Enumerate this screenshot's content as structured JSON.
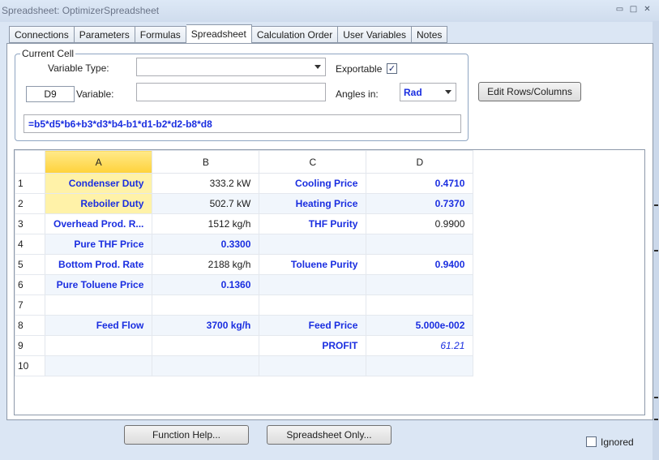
{
  "window": {
    "title": "Spreadsheet: OptimizerSpreadsheet",
    "controls": [
      "▭",
      "□",
      "✕"
    ]
  },
  "tabs": [
    "Connections",
    "Parameters",
    "Formulas",
    "Spreadsheet",
    "Calculation Order",
    "User Variables",
    "Notes"
  ],
  "active_tab": "Spreadsheet",
  "current_cell": {
    "legend": "Current Cell",
    "variable_type_label": "Variable Type:",
    "variable_type_value": "",
    "exportable_label": "Exportable",
    "exportable_checked": "✓",
    "cell_ref": "D9",
    "variable_label": "Variable:",
    "variable_value": "",
    "angles_label": "Angles in:",
    "angles_value": "Rad",
    "formula": "=b5*d5*b6+b3*d3*b4-b1*d1-b2*d2-b8*d8"
  },
  "edit_rows_button": "Edit Rows/Columns",
  "sheet": {
    "columns": [
      "A",
      "B",
      "C",
      "D"
    ],
    "rows": [
      {
        "n": "1",
        "a": "Condenser Duty",
        "b": "333.2 kW",
        "c": "Cooling Price",
        "d": "0.4710"
      },
      {
        "n": "2",
        "a": "Reboiler Duty",
        "b": "502.7 kW",
        "c": "Heating Price",
        "d": "0.7370"
      },
      {
        "n": "3",
        "a": "Overhead Prod. R...",
        "b": "1512 kg/h",
        "c": "THF Purity",
        "d": "0.9900"
      },
      {
        "n": "4",
        "a": "Pure THF Price",
        "b": "0.3300",
        "c": "",
        "d": ""
      },
      {
        "n": "5",
        "a": "Bottom Prod. Rate",
        "b": "2188 kg/h",
        "c": "Toluene Purity",
        "d": "0.9400"
      },
      {
        "n": "6",
        "a": "Pure Toluene Price",
        "b": "0.1360",
        "c": "",
        "d": ""
      },
      {
        "n": "7",
        "a": "",
        "b": "",
        "c": "",
        "d": ""
      },
      {
        "n": "8",
        "a": "Feed Flow",
        "b": "3700 kg/h",
        "c": "Feed Price",
        "d": "5.000e-002"
      },
      {
        "n": "9",
        "a": "",
        "b": "",
        "c": "PROFIT",
        "d": "61.21"
      },
      {
        "n": "10",
        "a": "",
        "b": "",
        "c": "",
        "d": ""
      }
    ]
  },
  "bottom": {
    "function_help": "Function Help...",
    "spreadsheet_only": "Spreadsheet Only...",
    "ignored_label": "Ignored"
  }
}
